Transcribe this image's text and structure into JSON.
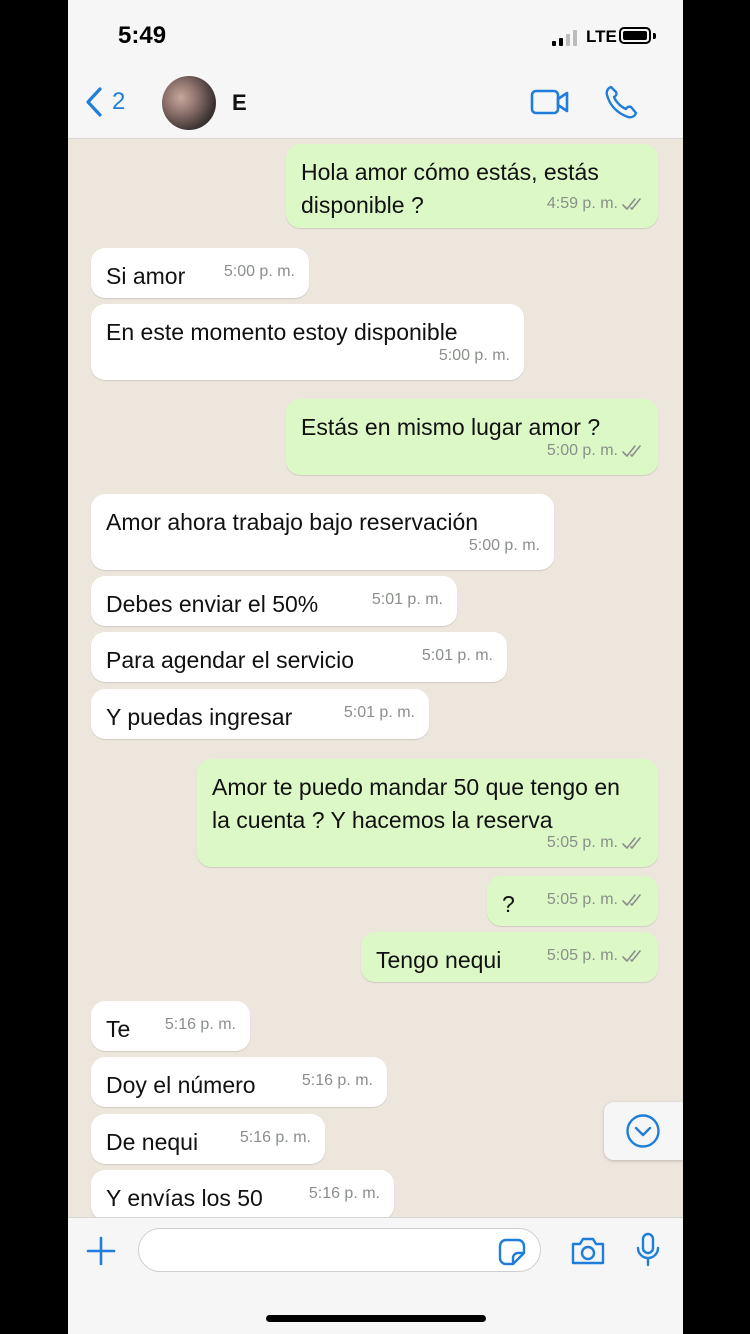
{
  "status": {
    "time": "5:49",
    "network": "LTE"
  },
  "header": {
    "back_count": "2",
    "contact_name": "E"
  },
  "messages": [
    {
      "dir": "out",
      "text": "Hola amor cómo estás, estás disponible ?",
      "time": "4:59 p. m."
    },
    {
      "dir": "in",
      "text": "Si amor",
      "time": "5:00 p. m."
    },
    {
      "dir": "in",
      "text": "En este momento estoy disponible",
      "time": "5:00 p. m."
    },
    {
      "dir": "out",
      "text": "Estás en mismo lugar amor ?",
      "time": "5:00 p. m."
    },
    {
      "dir": "in",
      "text": "Amor ahora trabajo bajo reservación",
      "time": "5:00 p. m."
    },
    {
      "dir": "in",
      "text": "Debes enviar el 50%",
      "time": "5:01 p. m."
    },
    {
      "dir": "in",
      "text": "Para agendar el servicio",
      "time": "5:01 p. m."
    },
    {
      "dir": "in",
      "text": "Y puedas ingresar",
      "time": "5:01 p. m."
    },
    {
      "dir": "out",
      "text": "Amor te puedo mandar 50 que tengo en la cuenta ? Y hacemos la reserva",
      "time": "5:05 p. m."
    },
    {
      "dir": "out",
      "text": "?",
      "time": "5:05 p. m."
    },
    {
      "dir": "out",
      "text": "Tengo nequi",
      "time": "5:05 p. m."
    },
    {
      "dir": "in",
      "text": "Te",
      "time": "5:16 p. m."
    },
    {
      "dir": "in",
      "text": "Doy el número",
      "time": "5:16 p. m."
    },
    {
      "dir": "in",
      "text": "De nequi",
      "time": "5:16 p. m."
    },
    {
      "dir": "in",
      "text": "Y envías los 50",
      "time": "5:16 p. m."
    }
  ],
  "composer": {
    "value": "",
    "placeholder": ""
  },
  "colors": {
    "accent": "#1f7ed9",
    "outgoing_bubble": "#dcf8c6",
    "incoming_bubble": "#ffffff",
    "chat_background": "#ece6dc"
  }
}
